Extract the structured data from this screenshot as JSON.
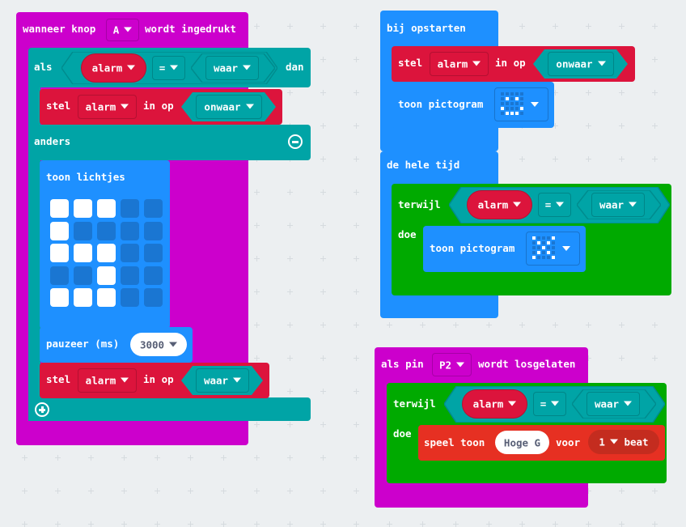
{
  "colors": {
    "events": "#cc00cc",
    "logic": "#00a4a6",
    "variables": "#dc143c",
    "basic": "#1e90ff",
    "loops": "#00aa00",
    "music": "#e63022",
    "background": "#eceff1"
  },
  "blocks": {
    "on_button": {
      "prefix": "wanneer knop",
      "button": "A",
      "suffix": "wordt ingedrukt",
      "if": {
        "label": "als",
        "condition": {
          "variable": "alarm",
          "operator": "=",
          "value": "waar"
        },
        "then_label": "dan",
        "then": {
          "set": "stel",
          "variable": "alarm",
          "to": "in op",
          "value": "onwaar"
        },
        "else_label": "anders",
        "else_show_leds": {
          "label": "toon lichtjes",
          "leds": [
            [
              1,
              1,
              1,
              0,
              0
            ],
            [
              1,
              0,
              0,
              0,
              0
            ],
            [
              1,
              1,
              1,
              0,
              0
            ],
            [
              0,
              0,
              1,
              0,
              0
            ],
            [
              1,
              1,
              1,
              0,
              0
            ]
          ]
        },
        "else_pause": {
          "label": "pauzeer (ms)",
          "value": "3000"
        },
        "else_set": {
          "set": "stel",
          "variable": "alarm",
          "to": "in op",
          "value": "waar"
        }
      }
    },
    "on_start": {
      "label": "bij opstarten",
      "set": {
        "set": "stel",
        "variable": "alarm",
        "to": "in op",
        "value": "onwaar"
      },
      "show_icon": {
        "label": "toon pictogram",
        "icon": "happy-icon",
        "pattern": [
          [
            0,
            0,
            0,
            0,
            0
          ],
          [
            0,
            1,
            0,
            1,
            0
          ],
          [
            0,
            0,
            0,
            0,
            0
          ],
          [
            1,
            0,
            0,
            0,
            1
          ],
          [
            0,
            1,
            1,
            1,
            0
          ]
        ]
      }
    },
    "forever": {
      "label": "de hele tijd",
      "while": {
        "label": "terwijl",
        "condition": {
          "variable": "alarm",
          "operator": "=",
          "value": "waar"
        },
        "do_label": "doe",
        "show_icon": {
          "label": "toon pictogram",
          "icon": "no-icon",
          "pattern": [
            [
              1,
              0,
              0,
              0,
              1
            ],
            [
              0,
              1,
              0,
              1,
              0
            ],
            [
              0,
              0,
              1,
              0,
              0
            ],
            [
              0,
              1,
              0,
              1,
              0
            ],
            [
              1,
              0,
              0,
              0,
              1
            ]
          ]
        }
      }
    },
    "on_pin_released": {
      "prefix": "als pin",
      "pin": "P2",
      "suffix": "wordt losgelaten",
      "while": {
        "label": "terwijl",
        "condition": {
          "variable": "alarm",
          "operator": "=",
          "value": "waar"
        },
        "do_label": "doe",
        "play_tone": {
          "label": "speel toon",
          "note": "Hoge G",
          "for_label": "voor",
          "beats": "1",
          "beat_label": "beat"
        }
      }
    }
  }
}
